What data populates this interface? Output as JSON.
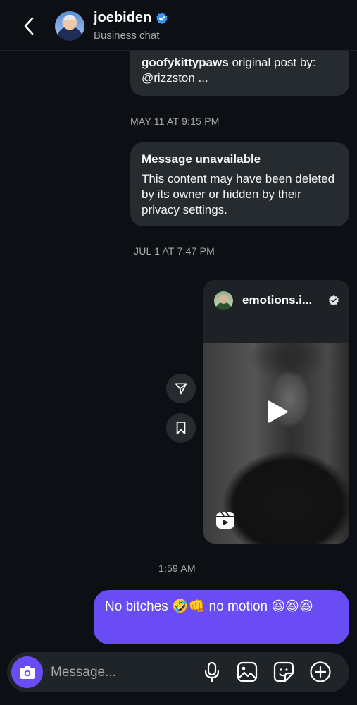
{
  "header": {
    "name": "joebiden",
    "subtitle": "Business chat",
    "icons": [
      "back-arrow-icon",
      "verified-badge-icon"
    ]
  },
  "messages": {
    "shared_post": {
      "author": "goofykittypaws",
      "text": " original post by: @rizzston ..."
    },
    "timestamp_1": "MAY 11 AT 9:15 PM",
    "unavailable": {
      "title": "Message unavailable",
      "body": "This content may have been deleted by its owner or hidden by their privacy settings."
    },
    "timestamp_2": "JUL 1 AT 7:47 PM",
    "reel": {
      "username": "emotions.i...",
      "icons": [
        "play-icon",
        "reels-icon",
        "verified-badge-icon",
        "share-icon",
        "bookmark-icon"
      ]
    },
    "timestamp_3": "1:59 AM",
    "outgoing": {
      "text": "No bitches 🤣👊 no motion 😆😆😆"
    }
  },
  "composer": {
    "placeholder": "Message...",
    "icons": [
      "camera-icon",
      "microphone-icon",
      "gallery-icon",
      "sticker-icon",
      "plus-icon"
    ]
  },
  "colors": {
    "background": "#0c1014",
    "bubble_incoming": "#262b30",
    "bubble_outgoing": "#6a4cf5",
    "accent": "#6a4cf5",
    "verified": "#3897f0"
  }
}
